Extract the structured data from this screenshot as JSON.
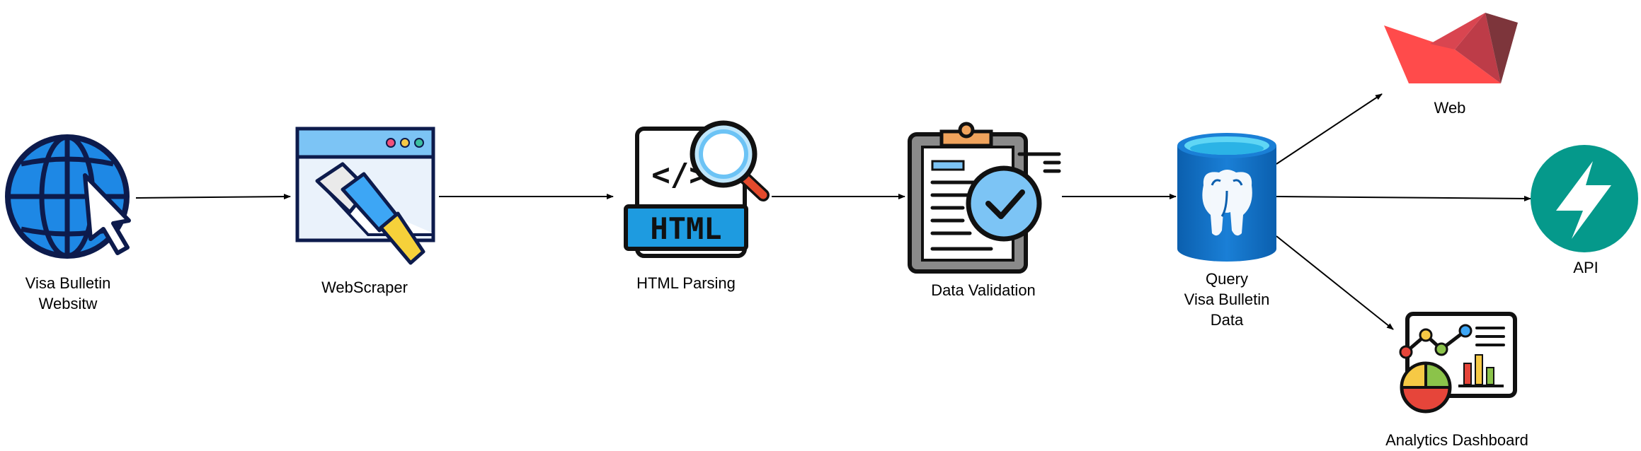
{
  "nodes": {
    "visa_website": {
      "lines": [
        "Visa Bulletin",
        "Websitw"
      ],
      "icon": "globe-cursor-icon"
    },
    "webscraper": {
      "lines": [
        "WebScraper"
      ],
      "icon": "browser-scraper-icon"
    },
    "html_parsing": {
      "lines": [
        "HTML Parsing"
      ],
      "icon": "html-magnifier-icon",
      "badge_text": "HTML",
      "code_glyph": "</>"
    },
    "data_validation": {
      "lines": [
        "Data Validation"
      ],
      "icon": "clipboard-check-icon"
    },
    "database": {
      "lines": [
        "Query",
        "Visa Bulletin",
        "Data"
      ],
      "icon": "postgresql-database-icon"
    },
    "web": {
      "lines": [
        "Web"
      ],
      "icon": "streamlit-logo-icon"
    },
    "api": {
      "lines": [
        "API"
      ],
      "icon": "fastapi-logo-icon"
    },
    "analytics": {
      "lines": [
        "Analytics Dashboard"
      ],
      "icon": "analytics-dashboard-icon"
    }
  },
  "edges": [
    {
      "from": "visa_website",
      "to": "webscraper"
    },
    {
      "from": "webscraper",
      "to": "html_parsing"
    },
    {
      "from": "html_parsing",
      "to": "data_validation"
    },
    {
      "from": "data_validation",
      "to": "database"
    },
    {
      "from": "database",
      "to": "web"
    },
    {
      "from": "database",
      "to": "api"
    },
    {
      "from": "database",
      "to": "analytics"
    }
  ],
  "colors": {
    "globe_blue": "#1e88e5",
    "outline_navy": "#0d1b4c",
    "html_blue": "#1e9be0",
    "streamlit_red": "#ff4b4b",
    "fastapi_teal": "#05998b",
    "db_blue": "#0a6fc4"
  }
}
